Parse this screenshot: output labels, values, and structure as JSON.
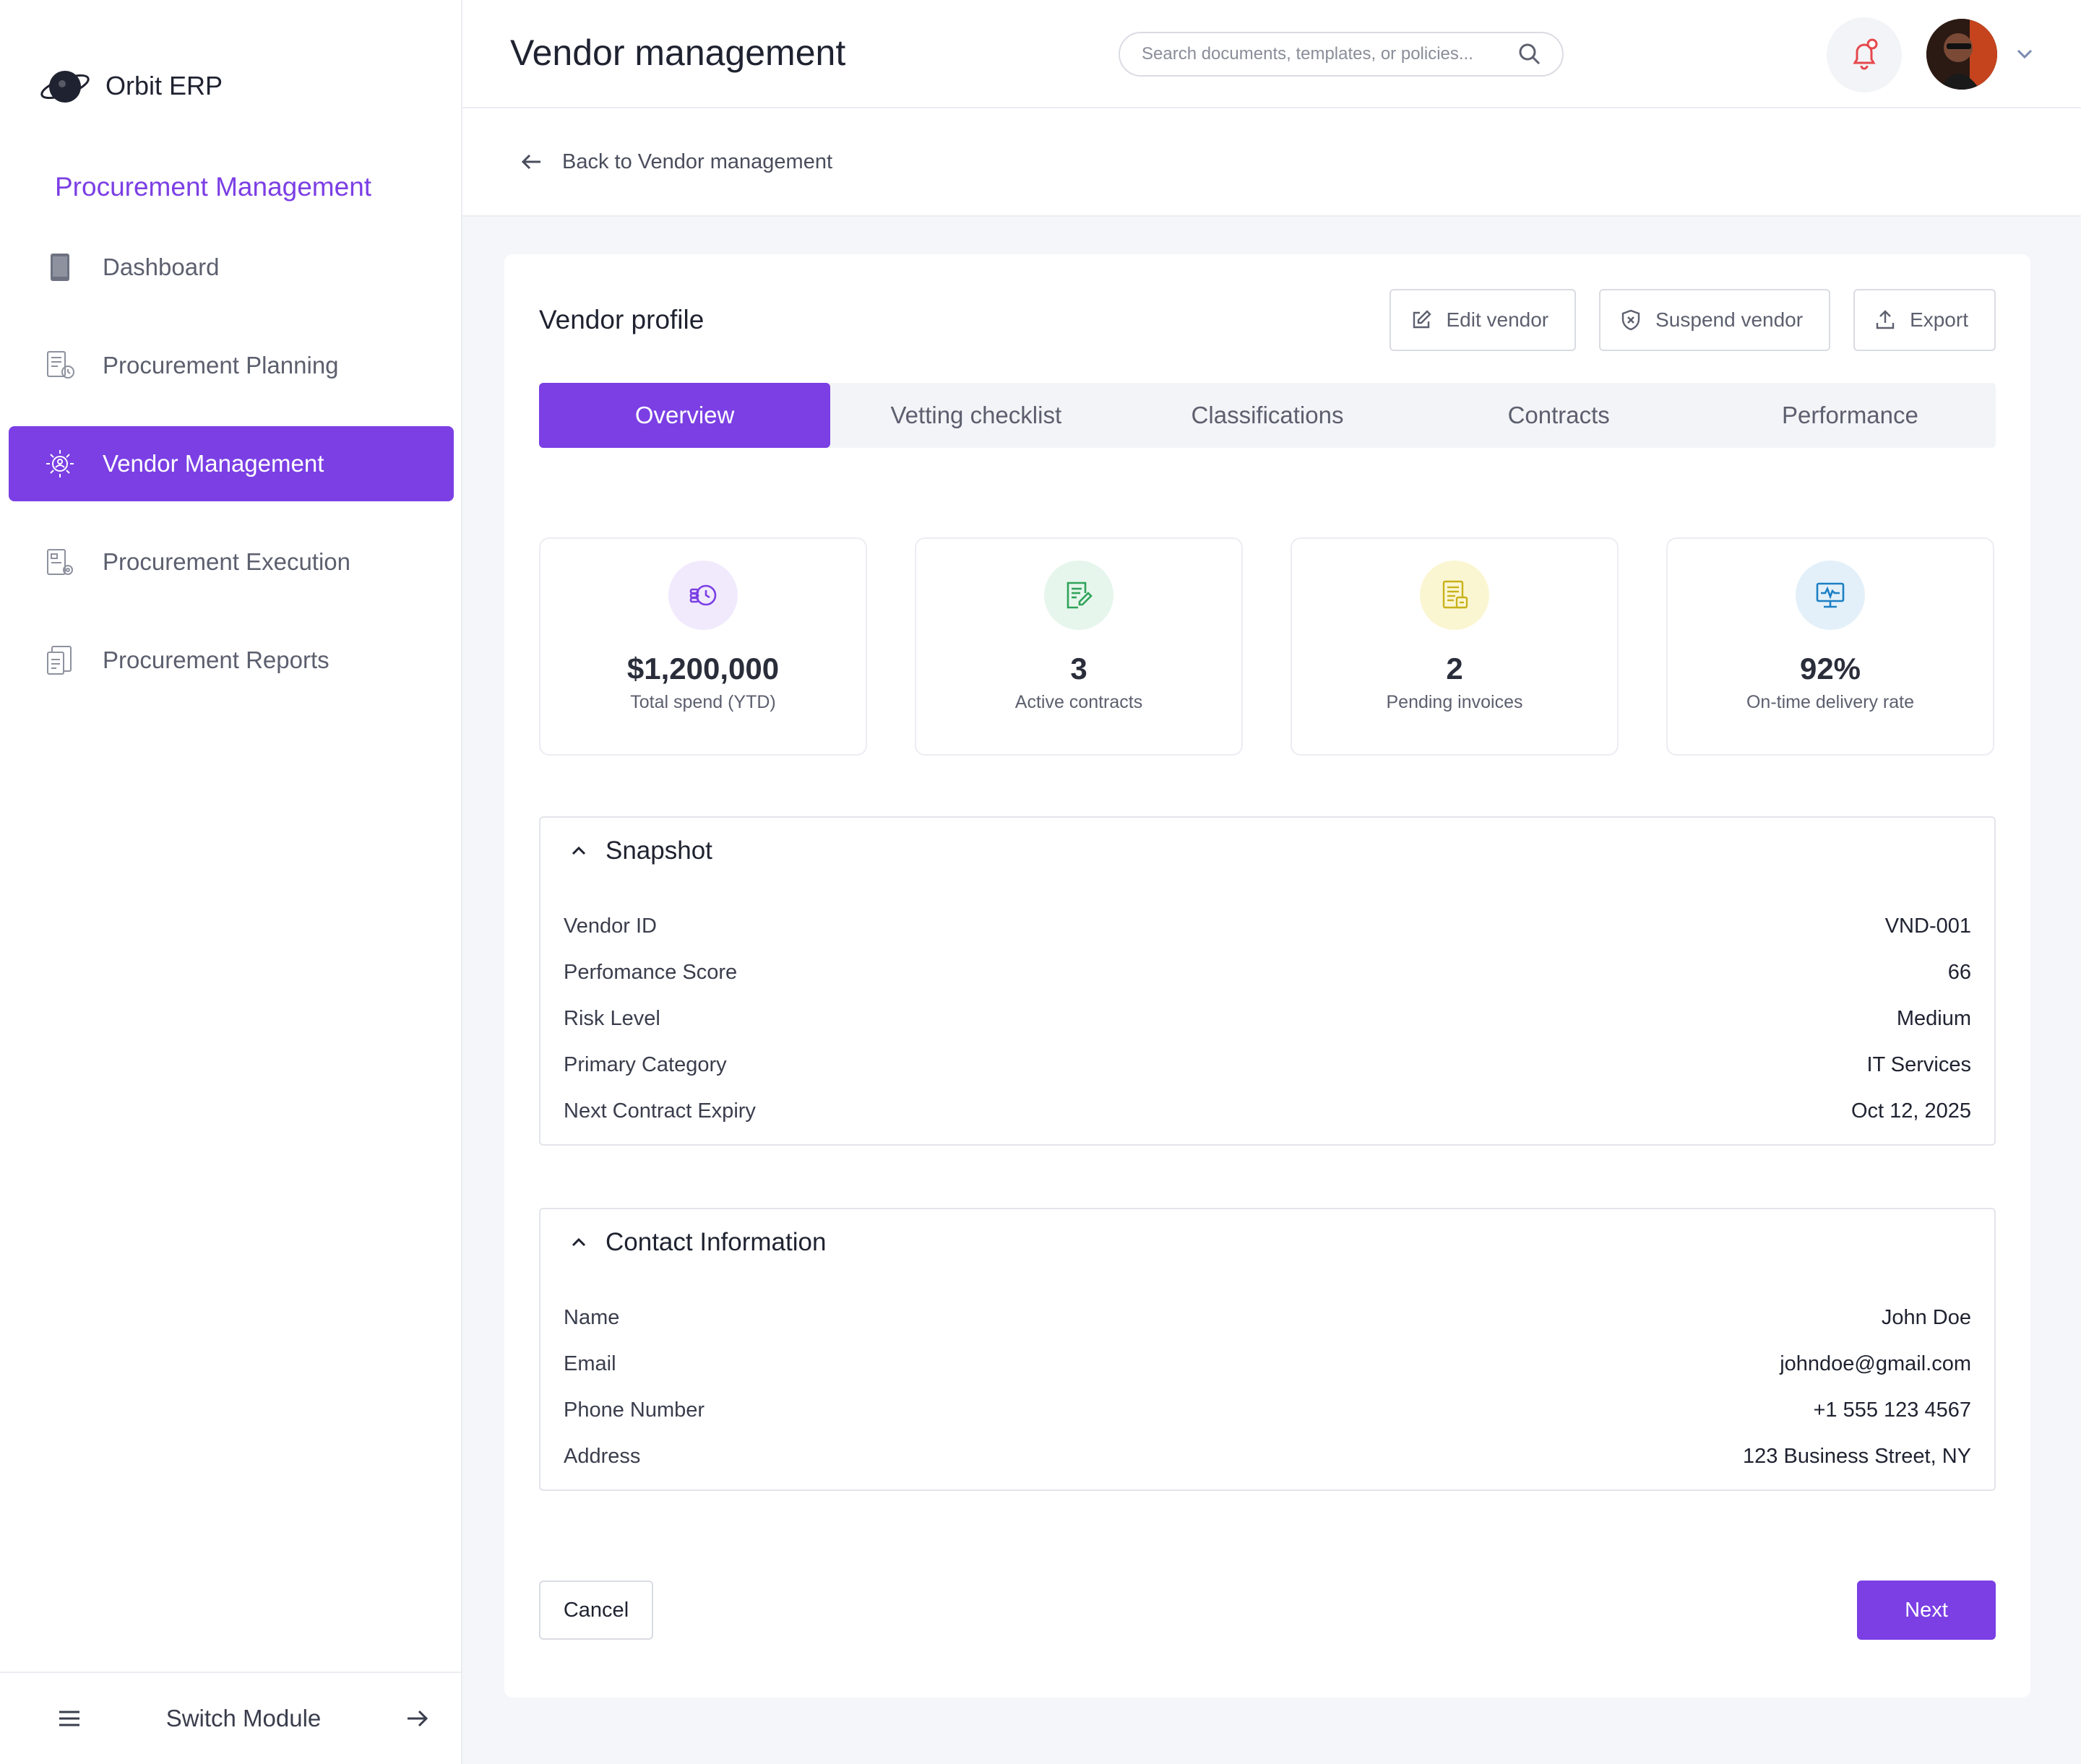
{
  "app": {
    "name": "Orbit ERP"
  },
  "sidebar": {
    "module_title": "Procurement Management",
    "items": [
      {
        "label": "Dashboard",
        "icon": "tablet-icon"
      },
      {
        "label": "Procurement Planning",
        "icon": "planning-icon"
      },
      {
        "label": "Vendor Management",
        "icon": "vendor-icon",
        "active": true
      },
      {
        "label": "Procurement Execution",
        "icon": "execution-icon"
      },
      {
        "label": "Procurement Reports",
        "icon": "reports-icon"
      }
    ],
    "switch_module": "Switch Module"
  },
  "header": {
    "title": "Vendor management",
    "search_placeholder": "Search documents, templates, or policies..."
  },
  "breadcrumb": {
    "back_label": "Back to Vendor management"
  },
  "profile": {
    "title": "Vendor profile",
    "actions": {
      "edit": "Edit vendor",
      "suspend": "Suspend vendor",
      "export": "Export"
    },
    "tabs": [
      "Overview",
      "Vetting checklist",
      "Classifications",
      "Contracts",
      "Performance"
    ],
    "active_tab": "Overview",
    "stats": [
      {
        "value": "$1,200,000",
        "label": "Total spend (YTD)",
        "icon": "spend-icon",
        "color": "#7B3FE4",
        "bg": "#F1EAFD"
      },
      {
        "value": "3",
        "label": "Active contracts",
        "icon": "contract-edit-icon",
        "color": "#2FA35A",
        "bg": "#E6F6EC"
      },
      {
        "value": "2",
        "label": "Pending invoices",
        "icon": "invoice-icon",
        "color": "#C9B21A",
        "bg": "#FBF6D2"
      },
      {
        "value": "92%",
        "label": "On-time delivery rate",
        "icon": "delivery-monitor-icon",
        "color": "#1C7FC4",
        "bg": "#E3F0F9"
      }
    ],
    "snapshot": {
      "title": "Snapshot",
      "rows": [
        {
          "label": "Vendor ID",
          "value": "VND-001"
        },
        {
          "label": "Perfomance Score",
          "value": "66"
        },
        {
          "label": "Risk Level",
          "value": "Medium"
        },
        {
          "label": "Primary Category",
          "value": "IT Services"
        },
        {
          "label": "Next Contract Expiry",
          "value": "Oct 12, 2025"
        }
      ]
    },
    "contact": {
      "title": "Contact Information",
      "rows": [
        {
          "label": "Name",
          "value": "John Doe"
        },
        {
          "label": "Email",
          "value": "johndoe@gmail.com"
        },
        {
          "label": "Phone Number",
          "value": "+1 555 123 4567"
        },
        {
          "label": "Address",
          "value": "123 Business Street, NY"
        }
      ]
    },
    "footer": {
      "cancel": "Cancel",
      "next": "Next"
    }
  },
  "colors": {
    "accent": "#7B3FE4",
    "notification": "#E5484D"
  }
}
